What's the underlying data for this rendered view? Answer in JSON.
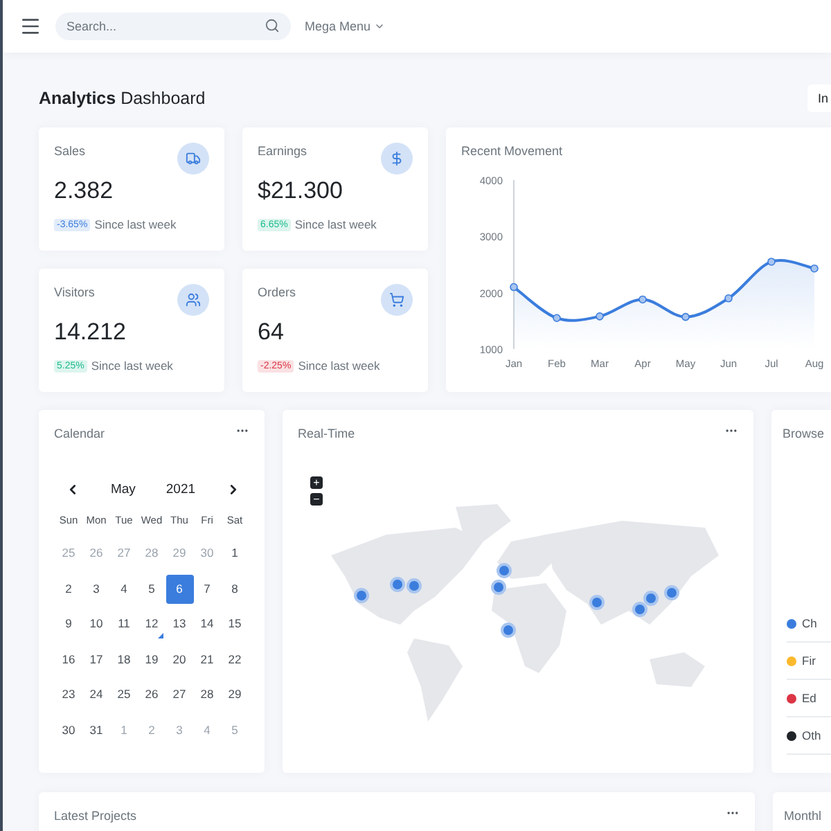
{
  "header": {
    "search": {
      "placeholder": "Search..."
    },
    "mega_menu": "Mega Menu"
  },
  "page": {
    "title_bold": "Analytics",
    "title_rest": "Dashboard",
    "action_button": "In"
  },
  "stats": [
    {
      "title": "Sales",
      "value": "2.382",
      "change": "-3.65%",
      "color": "#3b7ddd",
      "note": "Since last week"
    },
    {
      "title": "Earnings",
      "value": "$21.300",
      "change": "6.65%",
      "color": "#1cbb8c",
      "note": "Since last week"
    },
    {
      "title": "Visitors",
      "value": "14.212",
      "change": "5.25%",
      "color": "#1cbb8c",
      "note": "Since last week"
    },
    {
      "title": "Orders",
      "value": "64",
      "change": "-2.25%",
      "color": "#dc3545",
      "note": "Since last week"
    }
  ],
  "movement": {
    "title": "Recent Movement",
    "chart_data": {
      "type": "area",
      "categories": [
        "Jan",
        "Feb",
        "Mar",
        "Apr",
        "May",
        "Jun",
        "Jul",
        "Aug"
      ],
      "series": [
        {
          "color": "#3b7ddd",
          "values": [
            2100,
            1550,
            1580,
            1880,
            1570,
            1900,
            2550,
            2430
          ]
        }
      ],
      "ylim": [
        1000,
        4000
      ],
      "yticks": [
        1000,
        2000,
        3000,
        4000
      ]
    }
  },
  "calendar": {
    "title": "Calendar",
    "month": "May",
    "year": "2021",
    "weekdays": [
      "Sun",
      "Mon",
      "Tue",
      "Wed",
      "Thu",
      "Fri",
      "Sat"
    ],
    "days": [
      {
        "label": "25",
        "outside": true,
        "selected": false,
        "marked": false
      },
      {
        "label": "26",
        "outside": true,
        "selected": false,
        "marked": false
      },
      {
        "label": "27",
        "outside": true,
        "selected": false,
        "marked": false
      },
      {
        "label": "28",
        "outside": true,
        "selected": false,
        "marked": false
      },
      {
        "label": "29",
        "outside": true,
        "selected": false,
        "marked": false
      },
      {
        "label": "30",
        "outside": true,
        "selected": false,
        "marked": false
      },
      {
        "label": "1",
        "outside": false,
        "selected": false,
        "marked": false
      },
      {
        "label": "2",
        "outside": false,
        "selected": false,
        "marked": false
      },
      {
        "label": "3",
        "outside": false,
        "selected": false,
        "marked": false
      },
      {
        "label": "4",
        "outside": false,
        "selected": false,
        "marked": false
      },
      {
        "label": "5",
        "outside": false,
        "selected": false,
        "marked": false
      },
      {
        "label": "6",
        "outside": false,
        "selected": true,
        "marked": false
      },
      {
        "label": "7",
        "outside": false,
        "selected": false,
        "marked": false
      },
      {
        "label": "8",
        "outside": false,
        "selected": false,
        "marked": false
      },
      {
        "label": "9",
        "outside": false,
        "selected": false,
        "marked": false
      },
      {
        "label": "10",
        "outside": false,
        "selected": false,
        "marked": false
      },
      {
        "label": "11",
        "outside": false,
        "selected": false,
        "marked": false
      },
      {
        "label": "12",
        "outside": false,
        "selected": false,
        "marked": true
      },
      {
        "label": "13",
        "outside": false,
        "selected": false,
        "marked": false
      },
      {
        "label": "14",
        "outside": false,
        "selected": false,
        "marked": false
      },
      {
        "label": "15",
        "outside": false,
        "selected": false,
        "marked": false
      },
      {
        "label": "16",
        "outside": false,
        "selected": false,
        "marked": false
      },
      {
        "label": "17",
        "outside": false,
        "selected": false,
        "marked": false
      },
      {
        "label": "18",
        "outside": false,
        "selected": false,
        "marked": false
      },
      {
        "label": "19",
        "outside": false,
        "selected": false,
        "marked": false
      },
      {
        "label": "20",
        "outside": false,
        "selected": false,
        "marked": false
      },
      {
        "label": "21",
        "outside": false,
        "selected": false,
        "marked": false
      },
      {
        "label": "22",
        "outside": false,
        "selected": false,
        "marked": false
      },
      {
        "label": "23",
        "outside": false,
        "selected": false,
        "marked": false
      },
      {
        "label": "24",
        "outside": false,
        "selected": false,
        "marked": false
      },
      {
        "label": "25",
        "outside": false,
        "selected": false,
        "marked": false
      },
      {
        "label": "26",
        "outside": false,
        "selected": false,
        "marked": false
      },
      {
        "label": "27",
        "outside": false,
        "selected": false,
        "marked": false
      },
      {
        "label": "28",
        "outside": false,
        "selected": false,
        "marked": false
      },
      {
        "label": "29",
        "outside": false,
        "selected": false,
        "marked": false
      },
      {
        "label": "30",
        "outside": false,
        "selected": false,
        "marked": false
      },
      {
        "label": "31",
        "outside": false,
        "selected": false,
        "marked": false
      },
      {
        "label": "1",
        "outside": true,
        "selected": false,
        "marked": false
      },
      {
        "label": "2",
        "outside": true,
        "selected": false,
        "marked": false
      },
      {
        "label": "3",
        "outside": true,
        "selected": false,
        "marked": false
      },
      {
        "label": "4",
        "outside": true,
        "selected": false,
        "marked": false
      },
      {
        "label": "5",
        "outside": true,
        "selected": false,
        "marked": false
      }
    ]
  },
  "realtime": {
    "title": "Real-Time",
    "zoom_in": "+",
    "zoom_out": "−"
  },
  "browsers": {
    "title": "Browse",
    "items": [
      {
        "label": "Ch",
        "color": "#3b7ddd"
      },
      {
        "label": "Fir",
        "color": "#fcb92c"
      },
      {
        "label": "Ed",
        "color": "#dc3545"
      },
      {
        "label": "Oth",
        "color": "#212529"
      }
    ]
  },
  "bottom": {
    "projects_title": "Latest Projects",
    "monthly_title": "Monthl"
  }
}
